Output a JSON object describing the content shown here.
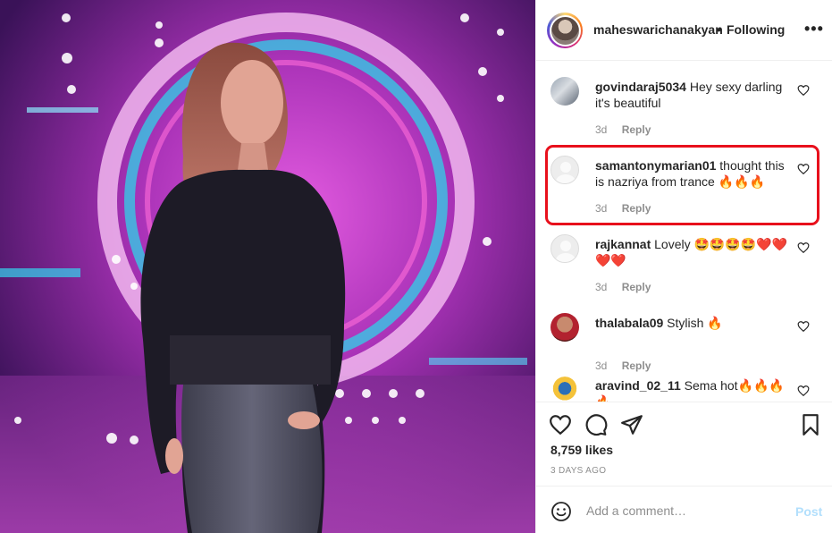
{
  "header": {
    "username": "maheswarichanakyan",
    "separator": "•",
    "follow_status": "Following",
    "more_icon": "more-horizontal-icon"
  },
  "comments": [
    {
      "username": "govindaraj5034",
      "text": "Hey sexy darling it's beautiful",
      "time": "3d",
      "reply": "Reply",
      "avatar": "photo"
    },
    {
      "username": "samantonymarian01",
      "text": "thought this is nazriya from trance 🔥🔥🔥",
      "time": "3d",
      "reply": "Reply",
      "avatar": "default",
      "highlighted": true
    },
    {
      "username": "rajkannat",
      "text": "Lovely 🤩🤩🤩🤩❤️❤️❤️❤️",
      "time": "3d",
      "reply": "Reply",
      "avatar": "default"
    },
    {
      "username": "thalabala09",
      "text": "Stylish 🔥",
      "time": "3d",
      "reply": "Reply",
      "avatar": "photo"
    },
    {
      "username": "aravind_02_11",
      "text": "Sema hot🔥🔥🔥🔥",
      "time": "",
      "reply": "",
      "avatar": "photo"
    }
  ],
  "actions": {
    "likes": "8,759 likes",
    "date": "3 DAYS AGO"
  },
  "add_comment": {
    "placeholder": "Add a comment…",
    "post_label": "Post"
  },
  "colors": {
    "highlight_border": "#e8101c",
    "post_disabled": "#b2dffc",
    "secondary_text": "#8e8e8e"
  }
}
